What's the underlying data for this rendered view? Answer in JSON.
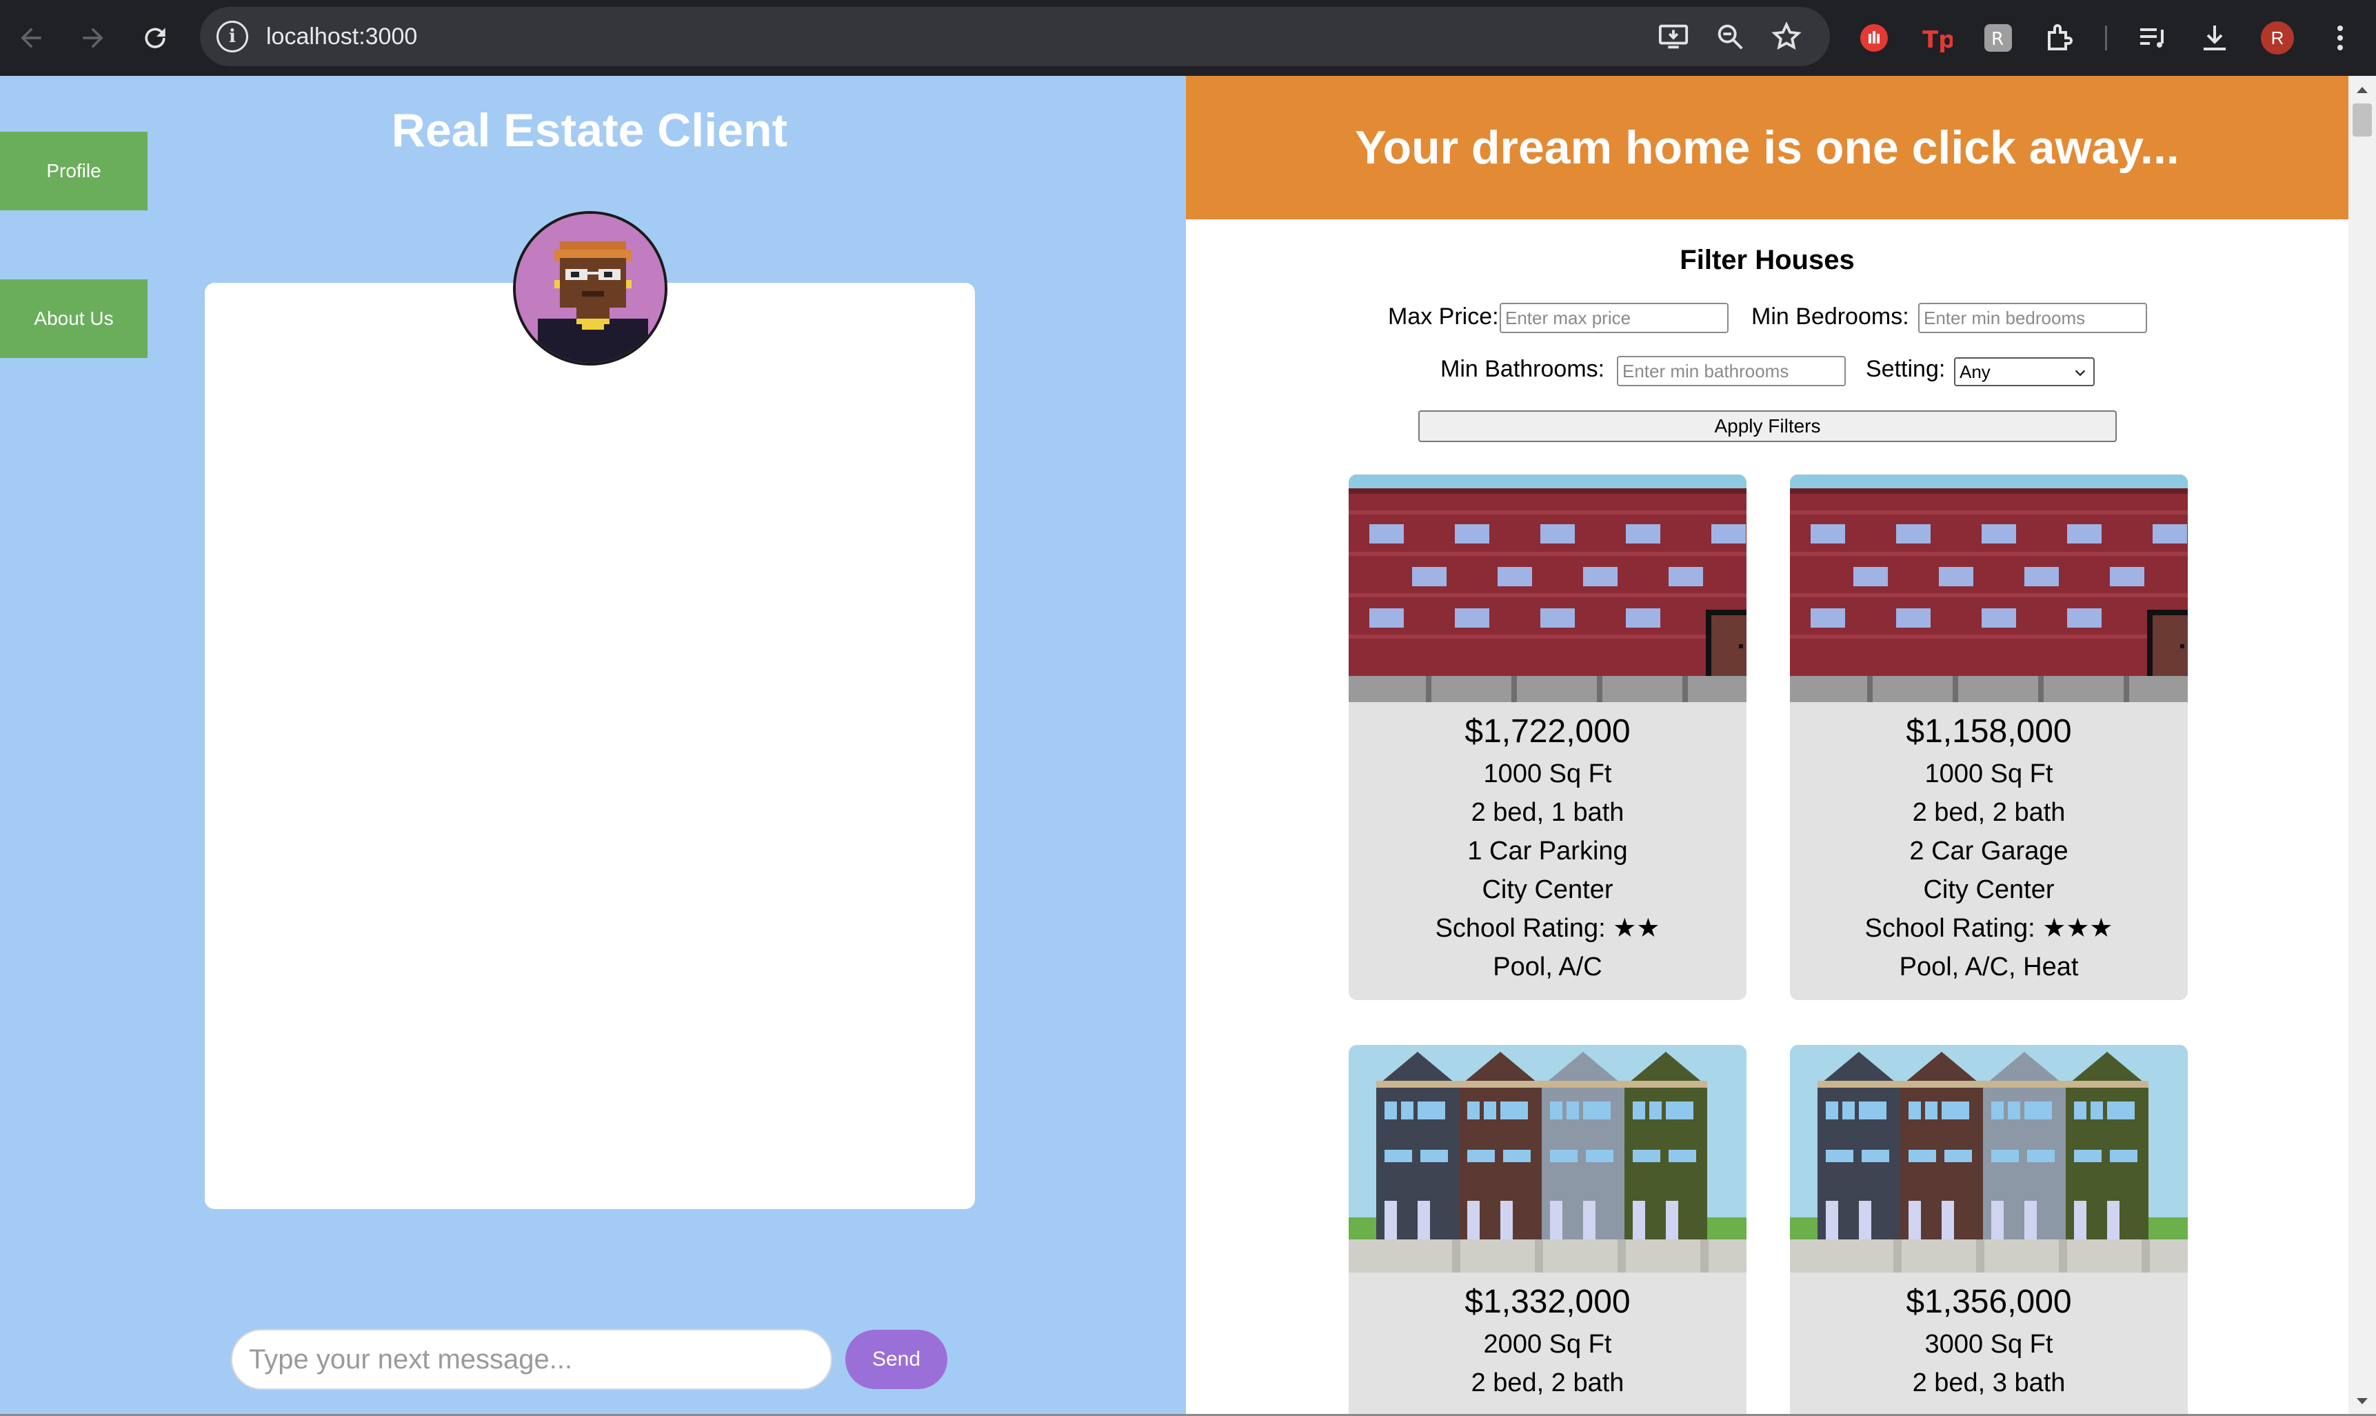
{
  "browser": {
    "url": "localhost:3000",
    "profile_initial": "R"
  },
  "left_panel": {
    "title": "Real Estate Client",
    "nav": [
      {
        "label": "Profile"
      },
      {
        "label": "About Us"
      }
    ],
    "message_input": {
      "placeholder": "Type your next message...",
      "value": ""
    },
    "send_label": "Send"
  },
  "right_panel": {
    "banner": "Your dream home is one click away...",
    "filters": {
      "title": "Filter Houses",
      "max_price_label": "Max Price:",
      "max_price_placeholder": "Enter max price",
      "min_bedrooms_label": "Min Bedrooms:",
      "min_bedrooms_placeholder": "Enter min bedrooms",
      "min_bathrooms_label": "Min Bathrooms:",
      "min_bathrooms_placeholder": "Enter min bathrooms",
      "setting_label": "Setting:",
      "setting_value": "Any",
      "apply_label": "Apply Filters"
    },
    "houses": [
      {
        "price": "$1,722,000",
        "sqft": "1000 Sq Ft",
        "bed_bath": "2 bed, 1 bath",
        "parking": "1 Car Parking",
        "setting": "City Center",
        "school": "School Rating: ★★",
        "amenities": "Pool, A/C",
        "image": "brick-apartment"
      },
      {
        "price": "$1,158,000",
        "sqft": "1000 Sq Ft",
        "bed_bath": "2 bed, 2 bath",
        "parking": "2 Car Garage",
        "setting": "City Center",
        "school": "School Rating: ★★★",
        "amenities": "Pool, A/C, Heat",
        "image": "brick-apartment"
      },
      {
        "price": "$1,332,000",
        "sqft": "2000 Sq Ft",
        "bed_bath": "2 bed, 2 bath",
        "image": "townhouses"
      },
      {
        "price": "$1,356,000",
        "sqft": "3000 Sq Ft",
        "bed_bath": "2 bed, 3 bath",
        "image": "townhouses"
      }
    ]
  },
  "colors": {
    "left_bg": "#a4cbf4",
    "banner": "#e38a35",
    "nav_button": "#6aae5b",
    "send_button": "#9b6fd8",
    "card_bg": "#e2e2e2"
  }
}
